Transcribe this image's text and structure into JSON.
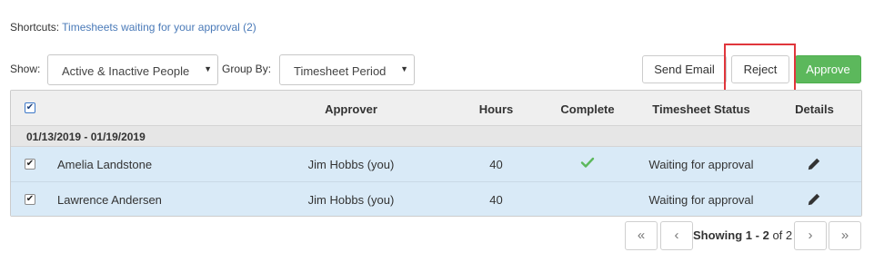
{
  "shortcuts": {
    "label": "Shortcuts:",
    "link": "Timesheets waiting for your approval (2)"
  },
  "toolbar": {
    "show_label": "Show:",
    "show_value": "Active & Inactive People",
    "groupby_label": "Group By:",
    "groupby_value": "Timesheet Period",
    "send_email": "Send Email",
    "reject": "Reject",
    "approve": "Approve"
  },
  "grid": {
    "columns": {
      "approver": "Approver",
      "hours": "Hours",
      "complete": "Complete",
      "status": "Timesheet Status",
      "details": "Details"
    },
    "group": "01/13/2019 - 01/19/2019",
    "rows": [
      {
        "name": "Amelia Landstone",
        "approver": "Jim Hobbs (you)",
        "hours": "40",
        "complete": true,
        "status": "Waiting for approval"
      },
      {
        "name": "Lawrence Andersen",
        "approver": "Jim Hobbs (you)",
        "hours": "40",
        "complete": false,
        "status": "Waiting for approval"
      }
    ]
  },
  "pager": {
    "showing": "Showing",
    "range": "1 - 2",
    "of": "of",
    "total": "2"
  },
  "colors": {
    "approve": "#5cb85c",
    "link": "#4a7ab8",
    "row_bg": "#d9eaf7",
    "check": "#5cb85c",
    "highlight": "#e0363c"
  }
}
